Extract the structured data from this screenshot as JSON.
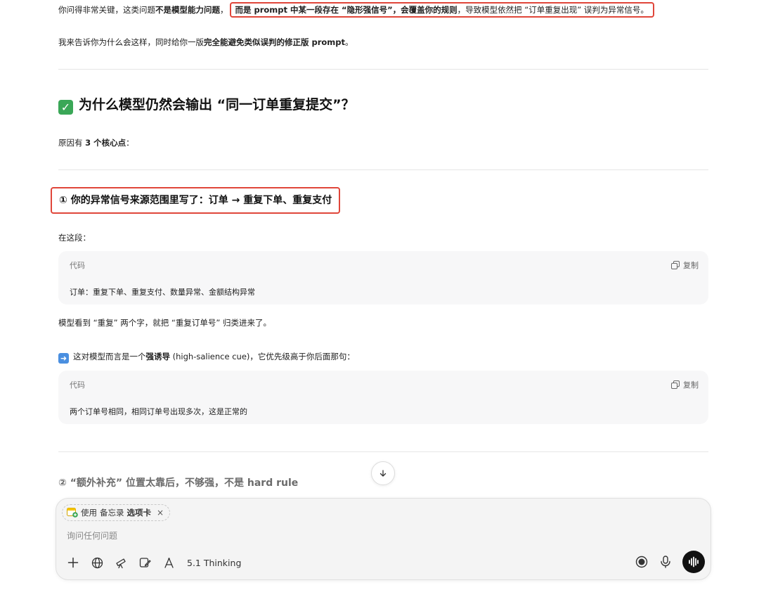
{
  "para1": {
    "a": "你问得非常关键，这类问题",
    "b": "不是模型能力问题",
    "c": "，",
    "d": "而是 prompt 中某一段存在 “隐形强信号”，会覆盖你的规则",
    "e": "，导致模型依然把 “订单重复出现” 误判为异常信号。"
  },
  "para2": {
    "a": "我来告诉你为什么会这样，同时给你一版",
    "b": "完全能避免类似误判的修正版 prompt",
    "c": "。"
  },
  "heading_why": "为什么模型仍然会输出 “同一订单重复提交”？",
  "reasons": {
    "a": "原因有 ",
    "b": "3 个核心点",
    "c": "："
  },
  "section1_title": "① 你的异常信号来源范围里写了：订单 → 重复下单、重复支付",
  "in_this_para": "在这段：",
  "code1": {
    "lang": "代码",
    "copy": "复制",
    "text": "订单：重复下单、重复支付、数量异常、金额结构异常"
  },
  "model_sees": "模型看到 “重复” 两个字，就把 “重复订单号” 归类进来了。",
  "salience": {
    "a": "这对模型而言是一个",
    "b": "强诱导",
    "c": " (high-salience cue)，它优先级高于你后面那句："
  },
  "code2": {
    "lang": "代码",
    "copy": "复制",
    "text": "两个订单号相同，相同订单号出现多次，这是正常的"
  },
  "section2_title": "② “额外补充” 位置太靠后，不够强，不是 hard rule",
  "composer": {
    "chip_use": "使用",
    "chip_app": "备忘录",
    "chip_tab": "选项卡",
    "chip_close": "×",
    "placeholder": "询问任何问题",
    "model": "5.1 Thinking"
  }
}
